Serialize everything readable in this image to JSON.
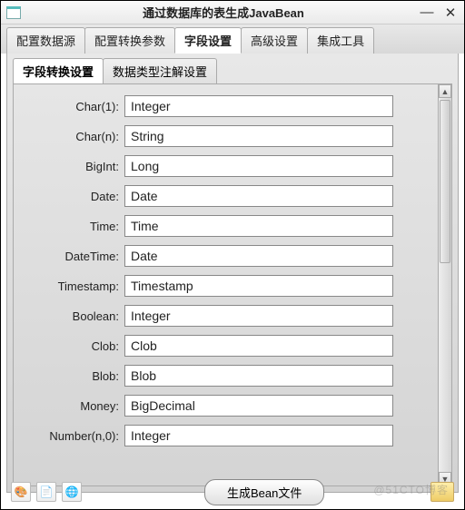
{
  "window": {
    "title": "通过数据库的表生成JavaBean"
  },
  "main_tabs": [
    "配置数据源",
    "配置转换参数",
    "字段设置",
    "高级设置",
    "集成工具"
  ],
  "main_tab_active": 2,
  "sub_tabs": [
    "字段转换设置",
    "数据类型注解设置"
  ],
  "sub_tab_active": 0,
  "fields": [
    {
      "label": "Char(1):",
      "value": "Integer"
    },
    {
      "label": "Char(n):",
      "value": "String"
    },
    {
      "label": "BigInt:",
      "value": "Long"
    },
    {
      "label": "Date:",
      "value": "Date"
    },
    {
      "label": "Time:",
      "value": "Time"
    },
    {
      "label": "DateTime:",
      "value": "Date"
    },
    {
      "label": "Timestamp:",
      "value": "Timestamp"
    },
    {
      "label": "Boolean:",
      "value": "Integer"
    },
    {
      "label": "Clob:",
      "value": "Clob"
    },
    {
      "label": "Blob:",
      "value": "Blob"
    },
    {
      "label": "Money:",
      "value": "BigDecimal"
    },
    {
      "label": "Number(n,0):",
      "value": "Integer"
    }
  ],
  "bottom": {
    "generate_label": "生成Bean文件"
  },
  "watermark": "@51CTO博客"
}
